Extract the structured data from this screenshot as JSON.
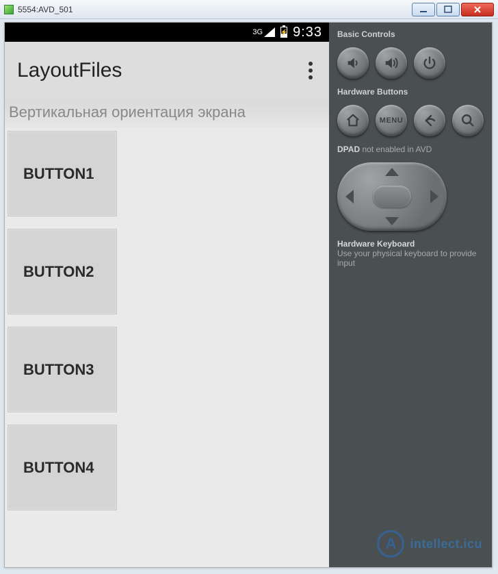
{
  "window": {
    "title": "5554:AVD_501"
  },
  "status": {
    "net": "3G",
    "time": "9:33"
  },
  "actionbar": {
    "title": "LayoutFiles"
  },
  "content": {
    "orientation_label": "Вертикальная ориентация экрана",
    "buttons": [
      "BUTTON1",
      "BUTTON2",
      "BUTTON3",
      "BUTTON4"
    ]
  },
  "panel": {
    "basic_label": "Basic Controls",
    "hw_label": "Hardware Buttons",
    "menu_text": "MENU",
    "dpad_label": "DPAD",
    "dpad_status": "not enabled in AVD",
    "hk_title": "Hardware Keyboard",
    "hk_sub": "Use your physical keyboard to provide input"
  },
  "watermark": {
    "letter": "A",
    "text": "intellect.icu"
  }
}
